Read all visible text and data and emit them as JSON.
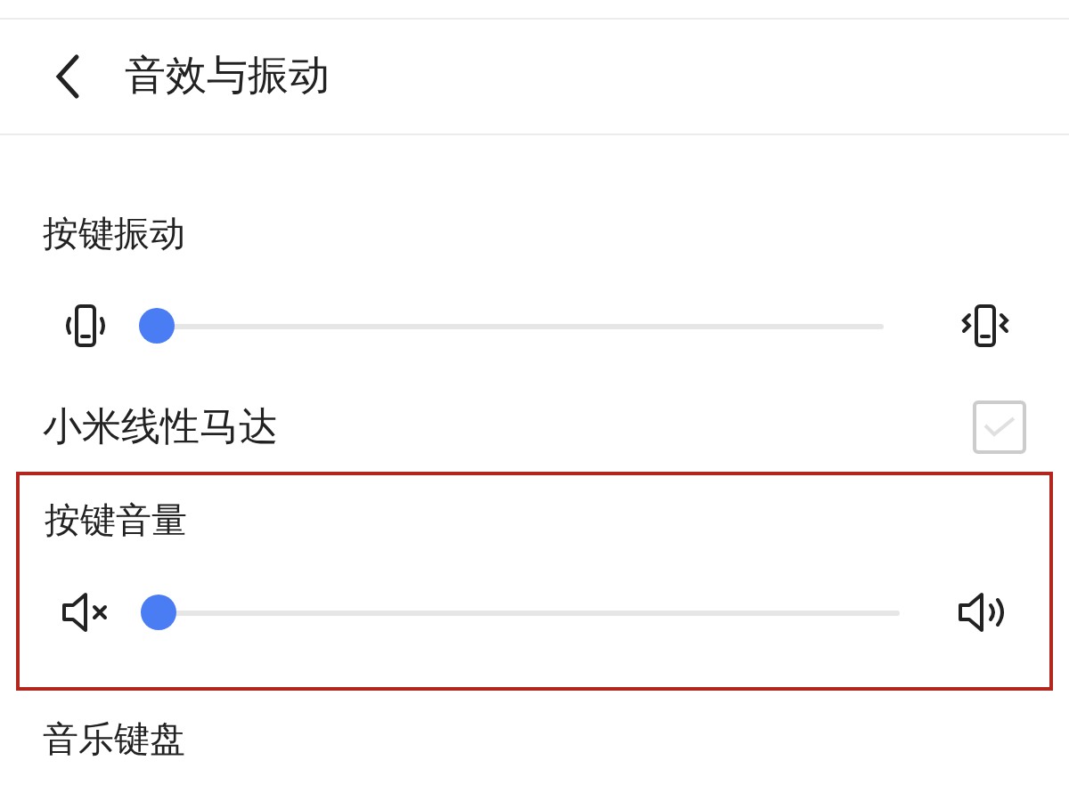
{
  "header": {
    "title": "音效与振动"
  },
  "items": [
    {
      "kind": "slider",
      "label": "按键振动",
      "slider": {
        "kind": "vibrate",
        "level": 0
      },
      "highlighted": false
    },
    {
      "kind": "checkbox",
      "label": "小米线性马达",
      "checked": false
    },
    {
      "kind": "slider",
      "label": "按键音量",
      "slider": {
        "kind": "volume",
        "level": 0
      },
      "highlighted": true
    },
    {
      "kind": "entry",
      "label": "音乐键盘"
    }
  ]
}
